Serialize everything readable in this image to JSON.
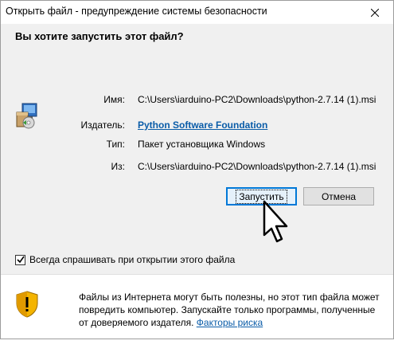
{
  "window": {
    "title": "Открыть файл - предупреждение системы безопасности"
  },
  "dialog": {
    "question": "Вы хотите запустить этот файл?",
    "fields": [
      {
        "label": "Имя:",
        "value": "C:\\Users\\iarduino-PC2\\Downloads\\python-2.7.14 (1).msi"
      },
      {
        "label": "Издатель:",
        "value": "Python Software Foundation"
      },
      {
        "label": "Тип:",
        "value": "Пакет установщика Windows"
      },
      {
        "label": "Из:",
        "value": "C:\\Users\\iarduino-PC2\\Downloads\\python-2.7.14 (1).msi"
      }
    ],
    "run_label": "Запустить",
    "cancel_label": "Отмена",
    "checkbox_label": "Всегда спрашивать при открытии этого файла",
    "checkbox_checked": true
  },
  "warning": {
    "text": "Файлы из Интернета могут быть полезны, но этот тип файла может повредить компьютер. Запускайте только программы, полученные от доверяемого издателя.",
    "link": "Факторы риска"
  },
  "icons": {
    "app": "installer-package-icon",
    "shield": "security-shield-icon",
    "close": "close-icon",
    "cursor": "mouse-pointer-icon"
  },
  "colors": {
    "accent": "#0078d7",
    "link": "#0a5ca8",
    "panel": "#f0f0f0"
  }
}
